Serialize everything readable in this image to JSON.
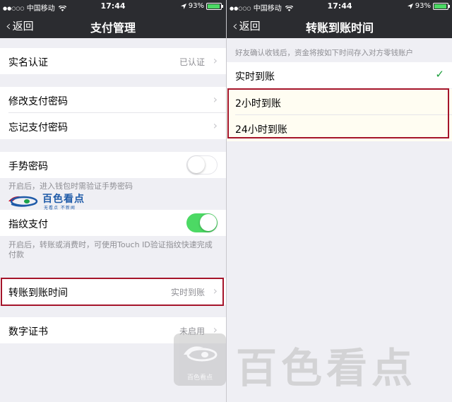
{
  "status": {
    "dots": "●●○○○",
    "carrier": "中国移动",
    "time": "17:44",
    "battery_pct": "93%",
    "battery_level": 0.93,
    "battery_color": "#4cd964"
  },
  "left": {
    "nav": {
      "back_label": "返回",
      "title": "支付管理"
    },
    "cells": {
      "real_name": {
        "label": "实名认证",
        "value": "已认证"
      },
      "change_password": {
        "label": "修改支付密码"
      },
      "forgot_password": {
        "label": "忘记支付密码"
      },
      "gesture": {
        "label": "手势密码",
        "enabled": false
      },
      "gesture_note": "开启后，进入钱包时需验证手势密码",
      "touch_id": {
        "label": "指纹支付",
        "enabled": true
      },
      "touch_id_note": "开启后，转账或消费时，可使用Touch ID验证指纹快速完成付款",
      "transfer_time": {
        "label": "转账到账时间",
        "value": "实时到账"
      },
      "certificate": {
        "label": "数字证书",
        "value": "未启用"
      }
    }
  },
  "right": {
    "nav": {
      "back_label": "返回",
      "title": "转账到账时间"
    },
    "header_note": "好友确认收钱后，资金将按如下时间存入对方零钱账户",
    "options": [
      {
        "label": "实时到账",
        "selected": true
      },
      {
        "label": "2小时到账",
        "selected": false
      },
      {
        "label": "24小时到账",
        "selected": false
      }
    ]
  },
  "watermark": {
    "small_name": "百色看点",
    "small_slogan": "无看点 不新闻",
    "big_text": "百色看点",
    "badge_caption": "百色看点"
  },
  "colors": {
    "highlight": "#a5142a",
    "toggle_on": "#4cd964",
    "checkmark": "#1a9e3a",
    "navbar": "#2b2c30"
  },
  "icons": {
    "wifi": "wifi-icon",
    "location": "location-icon",
    "back": "chevron-left-icon",
    "arrow": "chevron-right-icon",
    "check": "checkmark-icon"
  }
}
